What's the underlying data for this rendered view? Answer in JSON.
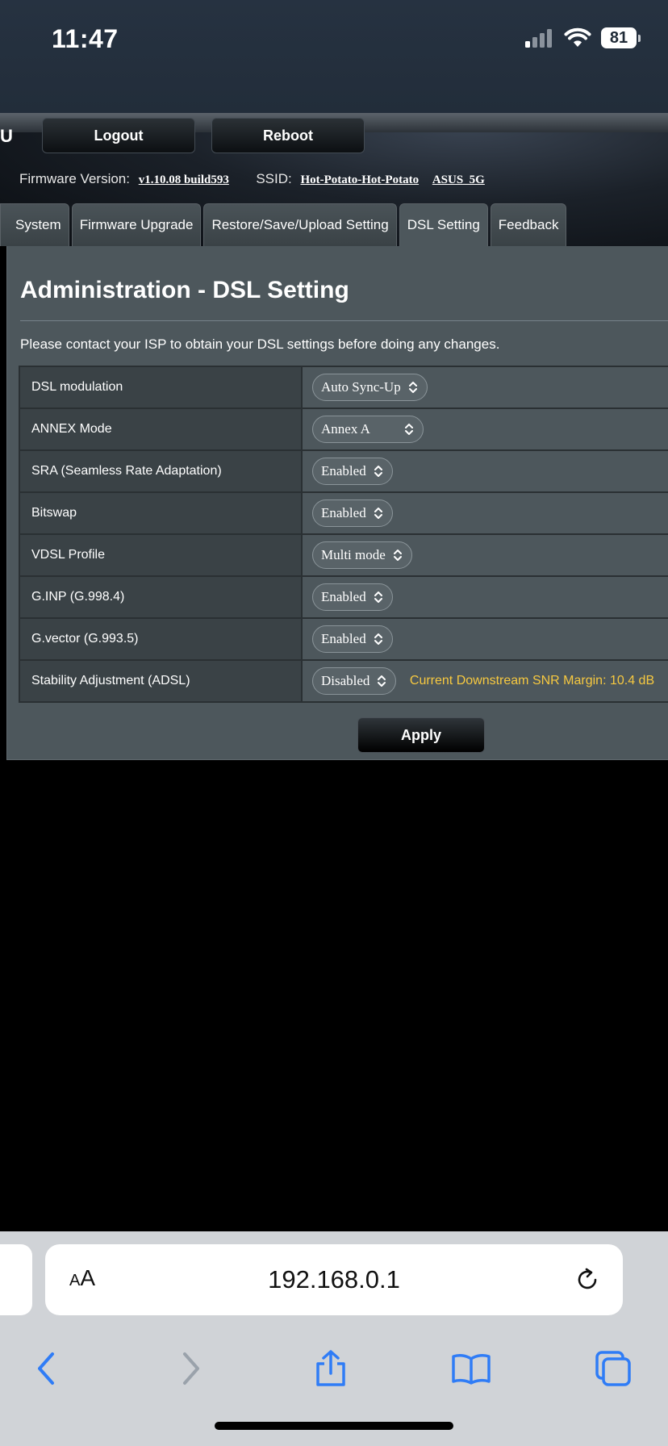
{
  "status_bar": {
    "time": "11:47",
    "battery_level": "81"
  },
  "header": {
    "brand_fragment": "U",
    "logout_label": "Logout",
    "reboot_label": "Reboot",
    "firmware_label": "Firmware Version:",
    "firmware_value": "v1.10.08 build593",
    "ssid_label": "SSID:",
    "ssid_values": [
      "Hot-Potato-Hot-Potato",
      "ASUS_5G"
    ]
  },
  "tabs": [
    {
      "label": "System",
      "active": false
    },
    {
      "label": "Firmware Upgrade",
      "active": false
    },
    {
      "label": "Restore/Save/Upload Setting",
      "active": false
    },
    {
      "label": "DSL Setting",
      "active": true
    },
    {
      "label": "Feedback",
      "active": false
    }
  ],
  "main": {
    "title": "Administration - DSL Setting",
    "notice": "Please contact your ISP to obtain your DSL settings before doing any changes.",
    "settings": [
      {
        "label": "DSL modulation",
        "value": "Auto Sync-Up"
      },
      {
        "label": "ANNEX Mode",
        "value": "Annex A"
      },
      {
        "label": "SRA (Seamless Rate Adaptation)",
        "value": "Enabled"
      },
      {
        "label": "Bitswap",
        "value": "Enabled"
      },
      {
        "label": "VDSL Profile",
        "value": "Multi mode"
      },
      {
        "label": "G.INP (G.998.4)",
        "value": "Enabled"
      },
      {
        "label": "G.vector (G.993.5)",
        "value": "Enabled"
      },
      {
        "label": "Stability Adjustment (ADSL)",
        "value": "Disabled",
        "note": "Current Downstream SNR Margin: 10.4 dB"
      }
    ],
    "apply_label": "Apply"
  },
  "browser": {
    "text_size_label_large": "A",
    "text_size_label_small": "A",
    "url": "192.168.0.1"
  },
  "colors": {
    "note": "#f7c940",
    "panel": "#4d575c",
    "link_blue": "#2f7cf6"
  },
  "icons": [
    "signal-icon",
    "wifi-icon",
    "battery-icon",
    "reload-icon",
    "back-icon",
    "forward-icon",
    "share-icon",
    "bookmarks-icon",
    "tabs-icon"
  ]
}
